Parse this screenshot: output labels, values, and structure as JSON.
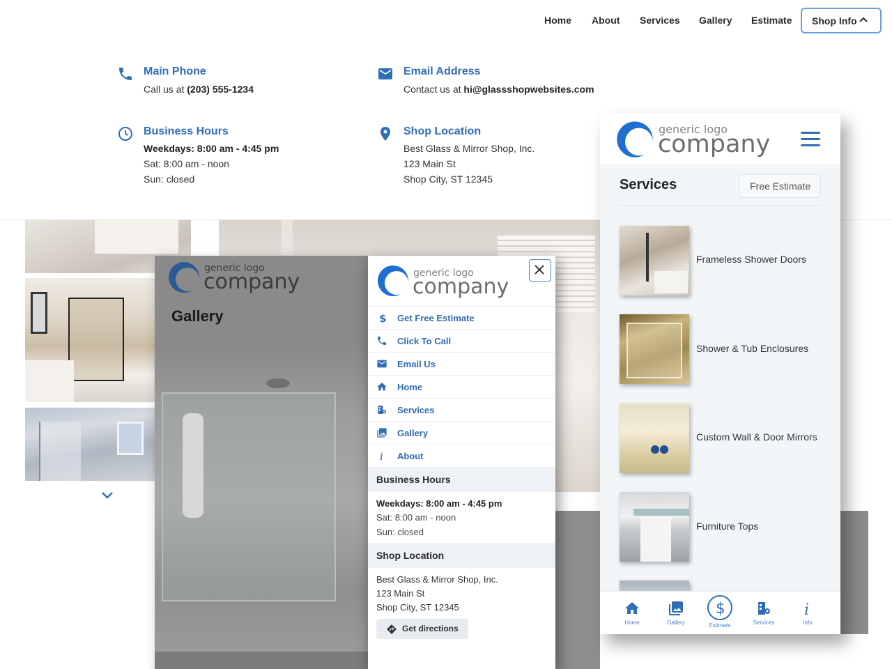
{
  "nav": {
    "items": [
      "Home",
      "About",
      "Services",
      "Gallery",
      "Estimate"
    ],
    "shop_info": "Shop Info"
  },
  "info": {
    "phone": {
      "title": "Main Phone",
      "prefix": "Call us at ",
      "value": "(203) 555-1234"
    },
    "email": {
      "title": "Email Address",
      "prefix": "Contact us at ",
      "value": "hi@glassshopwebsites.com"
    },
    "hours": {
      "title": "Business Hours",
      "weekdays": "Weekdays: 8:00 am - 4:45 pm",
      "sat": "Sat: 8:00 am - noon",
      "sun": "Sun: closed"
    },
    "location": {
      "title": "Shop Location",
      "name": "Best Glass & Mirror Shop, Inc.",
      "street": "123 Main St",
      "city": "Shop City, ST 12345"
    }
  },
  "logo": {
    "small": "generic logo",
    "big": "company"
  },
  "gallery_phone": {
    "title": "Gallery"
  },
  "side_menu": {
    "items": [
      {
        "label": "Get Free Estimate",
        "icon": "dollar-icon"
      },
      {
        "label": "Click To Call",
        "icon": "phone-icon"
      },
      {
        "label": "Email Us",
        "icon": "mail-icon"
      },
      {
        "label": "Home",
        "icon": "home-icon"
      },
      {
        "label": "Services",
        "icon": "services-icon"
      },
      {
        "label": "Gallery",
        "icon": "gallery-icon"
      },
      {
        "label": "About",
        "icon": "info-icon"
      }
    ],
    "hours_title": "Business Hours",
    "hours": {
      "weekdays": "Weekdays: 8:00 am - 4:45 pm",
      "sat": "Sat: 8:00 am - noon",
      "sun": "Sun: closed"
    },
    "location_title": "Shop Location",
    "location": {
      "name": "Best Glass & Mirror Shop, Inc.",
      "street": "123 Main St",
      "city": "Shop City, ST 12345"
    },
    "directions": "Get directions"
  },
  "services_phone": {
    "title": "Services",
    "estimate_button": "Free Estimate",
    "services": [
      "Frameless Shower Doors",
      "Shower & Tub Enclosures",
      "Custom Wall & Door Mirrors",
      "Furniture Tops"
    ],
    "bottom_nav": [
      "Home",
      "Gallery",
      "Estimate",
      "Services",
      "Info"
    ]
  },
  "colors": {
    "accent": "#2f6db5",
    "border_accent": "#6d9fd6"
  }
}
